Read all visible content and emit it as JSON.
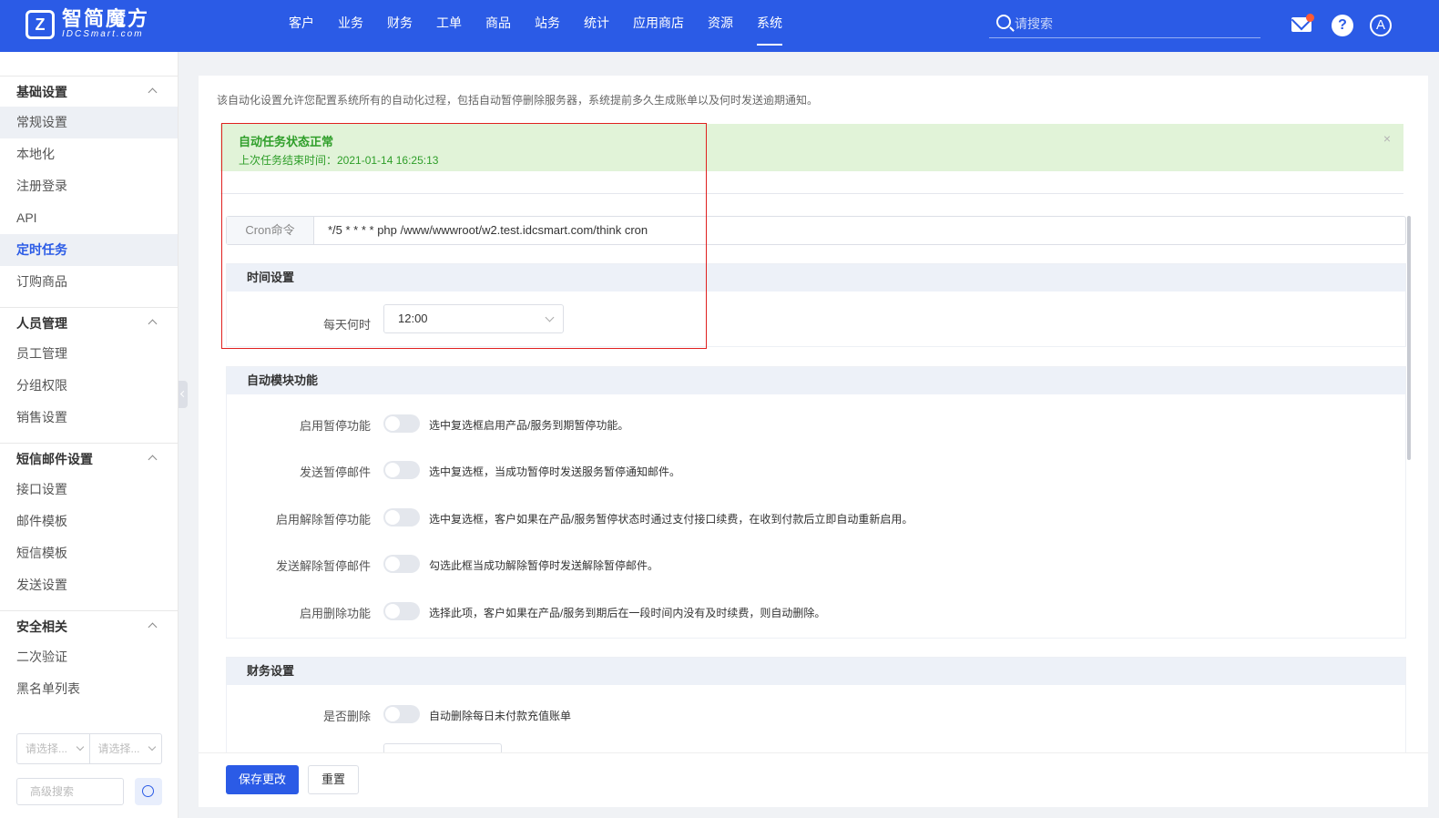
{
  "brand": {
    "mark": "Z",
    "name_cn": "智简魔方",
    "name_en": "IDCSmart.com"
  },
  "nav": {
    "items": [
      {
        "label": "客户"
      },
      {
        "label": "业务"
      },
      {
        "label": "财务"
      },
      {
        "label": "工单"
      },
      {
        "label": "商品"
      },
      {
        "label": "站务"
      },
      {
        "label": "统计"
      },
      {
        "label": "应用商店"
      },
      {
        "label": "资源"
      },
      {
        "label": "系统",
        "active": true
      }
    ],
    "search_placeholder": "请搜索",
    "help_glyph": "?",
    "avatar_initial": "A"
  },
  "sidebar": {
    "groups": [
      {
        "title": "基础设置",
        "items": [
          "常规设置",
          "本地化",
          "注册登录",
          "API",
          "定时任务",
          "订购商品"
        ]
      },
      {
        "title": "人员管理",
        "items": [
          "员工管理",
          "分组权限",
          "销售设置"
        ]
      },
      {
        "title": "短信邮件设置",
        "items": [
          "接口设置",
          "邮件模板",
          "短信模板",
          "发送设置"
        ]
      },
      {
        "title": "安全相关",
        "items": [
          "二次验证",
          "黑名单列表"
        ]
      }
    ],
    "filter_select_1": "请选择...",
    "filter_select_2": "请选择...",
    "advanced_search_placeholder": "高级搜索"
  },
  "main": {
    "intro": "该自动化设置允许您配置系统所有的自动化过程，包括自动暂停删除服务器，系统提前多久生成账单以及何时发送逾期通知。",
    "alert": {
      "title": "自动任务状态正常",
      "subtitle": "上次任务结束时间：2021-01-14 16:25:13",
      "close": "×"
    },
    "cron": {
      "label": "Cron命令",
      "value": "*/5 * * * * php /www/wwwroot/w2.test.idcsmart.com/think cron"
    },
    "time_section": {
      "title": "时间设置",
      "field_label": "每天何时",
      "field_value": "12:00"
    },
    "auto_section": {
      "title": "自动模块功能",
      "rows": [
        {
          "label": "启用暂停功能",
          "desc": "选中复选框启用产品/服务到期暂停功能。",
          "enabled": false
        },
        {
          "label": "发送暂停邮件",
          "desc": "选中复选框，当成功暂停时发送服务暂停通知邮件。",
          "enabled": false
        },
        {
          "label": "启用解除暂停功能",
          "desc": "选中复选框，客户如果在产品/服务暂停状态时通过支付接口续费，在收到付款后立即自动重新启用。",
          "enabled": false
        },
        {
          "label": "发送解除暂停邮件",
          "desc": "勾选此框当成功解除暂停时发送解除暂停邮件。",
          "enabled": false
        },
        {
          "label": "启用删除功能",
          "desc": "选择此项，客户如果在产品/服务到期后在一段时间内没有及时续费，则自动删除。",
          "enabled": false
        }
      ]
    },
    "finance_section": {
      "title": "财务设置",
      "rows": [
        {
          "label": "是否删除",
          "desc": "自动删除每日未付款充值账单",
          "enabled": false
        }
      ]
    }
  },
  "footer": {
    "save_label": "保存更改",
    "reset_label": "重置"
  },
  "colors": {
    "primary": "#2b5be6",
    "success_bg": "#e1f3d8",
    "success_text": "#2e9e29",
    "highlight": "#e0201f"
  }
}
